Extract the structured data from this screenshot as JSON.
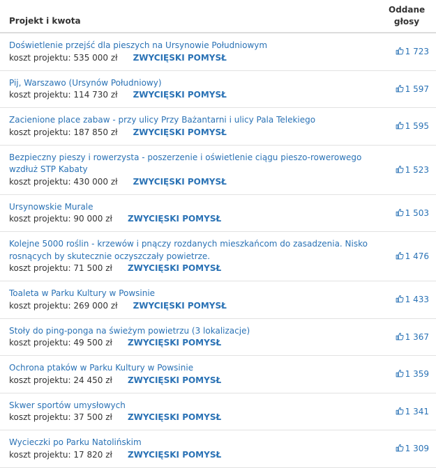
{
  "header": {
    "project_col": "Projekt i kwota",
    "votes_col_line1": "Oddane",
    "votes_col_line2": "głosy"
  },
  "rows": [
    {
      "title": "Doświetlenie przejść dla pieszych na Ursynowie Południowym",
      "cost_label": "koszt projektu:",
      "cost": "535 000 zł",
      "badge": "ZWYCIĘSKI POMYSŁ",
      "votes": "1 723"
    },
    {
      "title": "Pij, Warszawo (Ursynów Południowy)",
      "cost_label": "koszt projektu:",
      "cost": "114 730 zł",
      "badge": "ZWYCIĘSKI POMYSŁ",
      "votes": "1 597"
    },
    {
      "title": "Zacienione place zabaw - przy ulicy Przy Bażantarni i ulicy Pala Telekiego",
      "cost_label": "koszt projektu:",
      "cost": "187 850 zł",
      "badge": "ZWYCIĘSKI POMYSŁ",
      "votes": "1 595"
    },
    {
      "title": "Bezpieczny pieszy i rowerzysta - poszerzenie i oświetlenie ciągu pieszo-rowerowego wzdłuż STP Kabaty",
      "cost_label": "koszt projektu:",
      "cost": "430 000 zł",
      "badge": "ZWYCIĘSKI POMYSŁ",
      "votes": "1 523"
    },
    {
      "title": "Ursynowskie Murale",
      "cost_label": "koszt projektu:",
      "cost": "90 000 zł",
      "badge": "ZWYCIĘSKI POMYSŁ",
      "votes": "1 503"
    },
    {
      "title": "Kolejne 5000 roślin - krzewów i pnączy rozdanych mieszkańcom do zasadzenia. Nisko rosnących by skutecznie oczyszczały powietrze.",
      "cost_label": "koszt projektu:",
      "cost": "71 500 zł",
      "badge": "ZWYCIĘSKI POMYSŁ",
      "votes": "1 476"
    },
    {
      "title": "Toaleta w Parku Kultury w Powsinie",
      "cost_label": "koszt projektu:",
      "cost": "269 000 zł",
      "badge": "ZWYCIĘSKI POMYSŁ",
      "votes": "1 433"
    },
    {
      "title": "Stoły do ping-ponga na świeżym powietrzu (3 lokalizacje)",
      "cost_label": "koszt projektu:",
      "cost": "49 500 zł",
      "badge": "ZWYCIĘSKI POMYSŁ",
      "votes": "1 367"
    },
    {
      "title": "Ochrona ptaków w Parku Kultury w Powsinie",
      "cost_label": "koszt projektu:",
      "cost": "24 450 zł",
      "badge": "ZWYCIĘSKI POMYSŁ",
      "votes": "1 359"
    },
    {
      "title": "Skwer sportów umysłowych",
      "cost_label": "koszt projektu:",
      "cost": "37 500 zł",
      "badge": "ZWYCIĘSKI POMYSŁ",
      "votes": "1 341"
    },
    {
      "title": "Wycieczki po Parku Natolińskim",
      "cost_label": "koszt projektu:",
      "cost": "17 820 zł",
      "badge": "ZWYCIĘSKI POMYSŁ",
      "votes": "1 309"
    }
  ],
  "colors": {
    "link": "#2a72b5",
    "text": "#333333",
    "divider": "#e2e2e2"
  },
  "icons": {
    "votes": "thumbs-up-icon"
  }
}
